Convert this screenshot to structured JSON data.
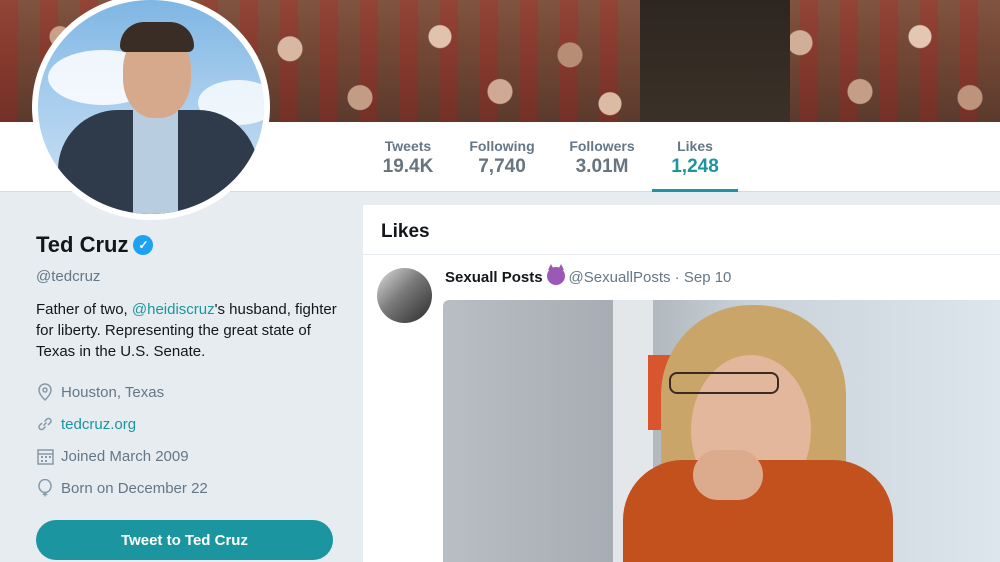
{
  "nav": {
    "stats": [
      {
        "label": "Tweets",
        "value": "19.4K"
      },
      {
        "label": "Following",
        "value": "7,740"
      },
      {
        "label": "Followers",
        "value": "3.01M"
      },
      {
        "label": "Likes",
        "value": "1,248"
      }
    ],
    "active_tab": "Likes"
  },
  "profile": {
    "name": "Ted Cruz",
    "handle": "@tedcruz",
    "bio_prefix": "Father of two, ",
    "bio_link": "@heidiscruz",
    "bio_suffix": "'s husband, fighter for liberty. Representing the great state of Texas in the U.S. Senate.",
    "location": "Houston, Texas",
    "website": "tedcruz.org",
    "joined": "Joined March 2009",
    "birthday": "Born on December 22",
    "tweet_button": "Tweet to Ted Cruz"
  },
  "timeline": {
    "title": "Likes",
    "tweet": {
      "name": "Sexuall Posts",
      "handle": "@SexuallPosts",
      "date": "Sep 10",
      "separator": "·"
    }
  },
  "colors": {
    "accent": "#1b95a0",
    "verified": "#1da1f2"
  },
  "icons": [
    "location-icon",
    "link-icon",
    "calendar-icon",
    "balloon-icon",
    "verified-badge-icon",
    "devil-emoji-icon"
  ]
}
